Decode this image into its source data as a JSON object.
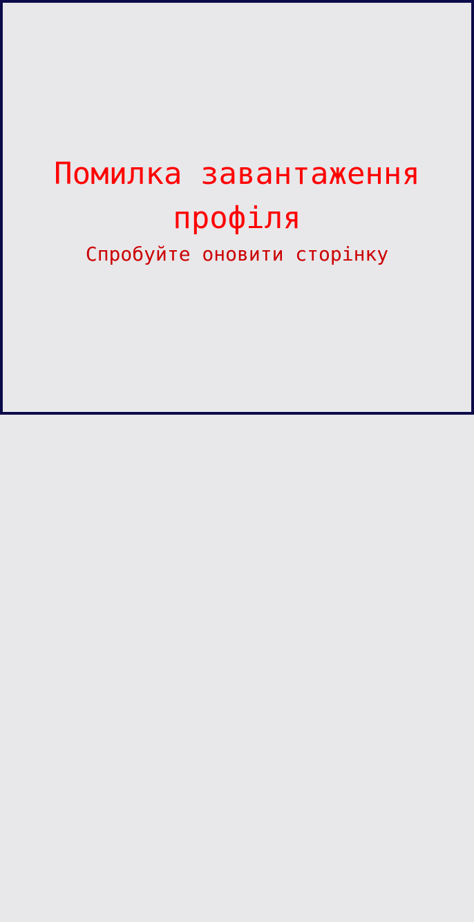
{
  "error": {
    "title": "Помилка завантаження профіля",
    "subtitle": "Спробуйте оновити сторінку"
  },
  "colors": {
    "background": "#e8e7ea",
    "border": "#0d0a4a",
    "title": "#ff0000",
    "subtitle": "#cc0000"
  }
}
